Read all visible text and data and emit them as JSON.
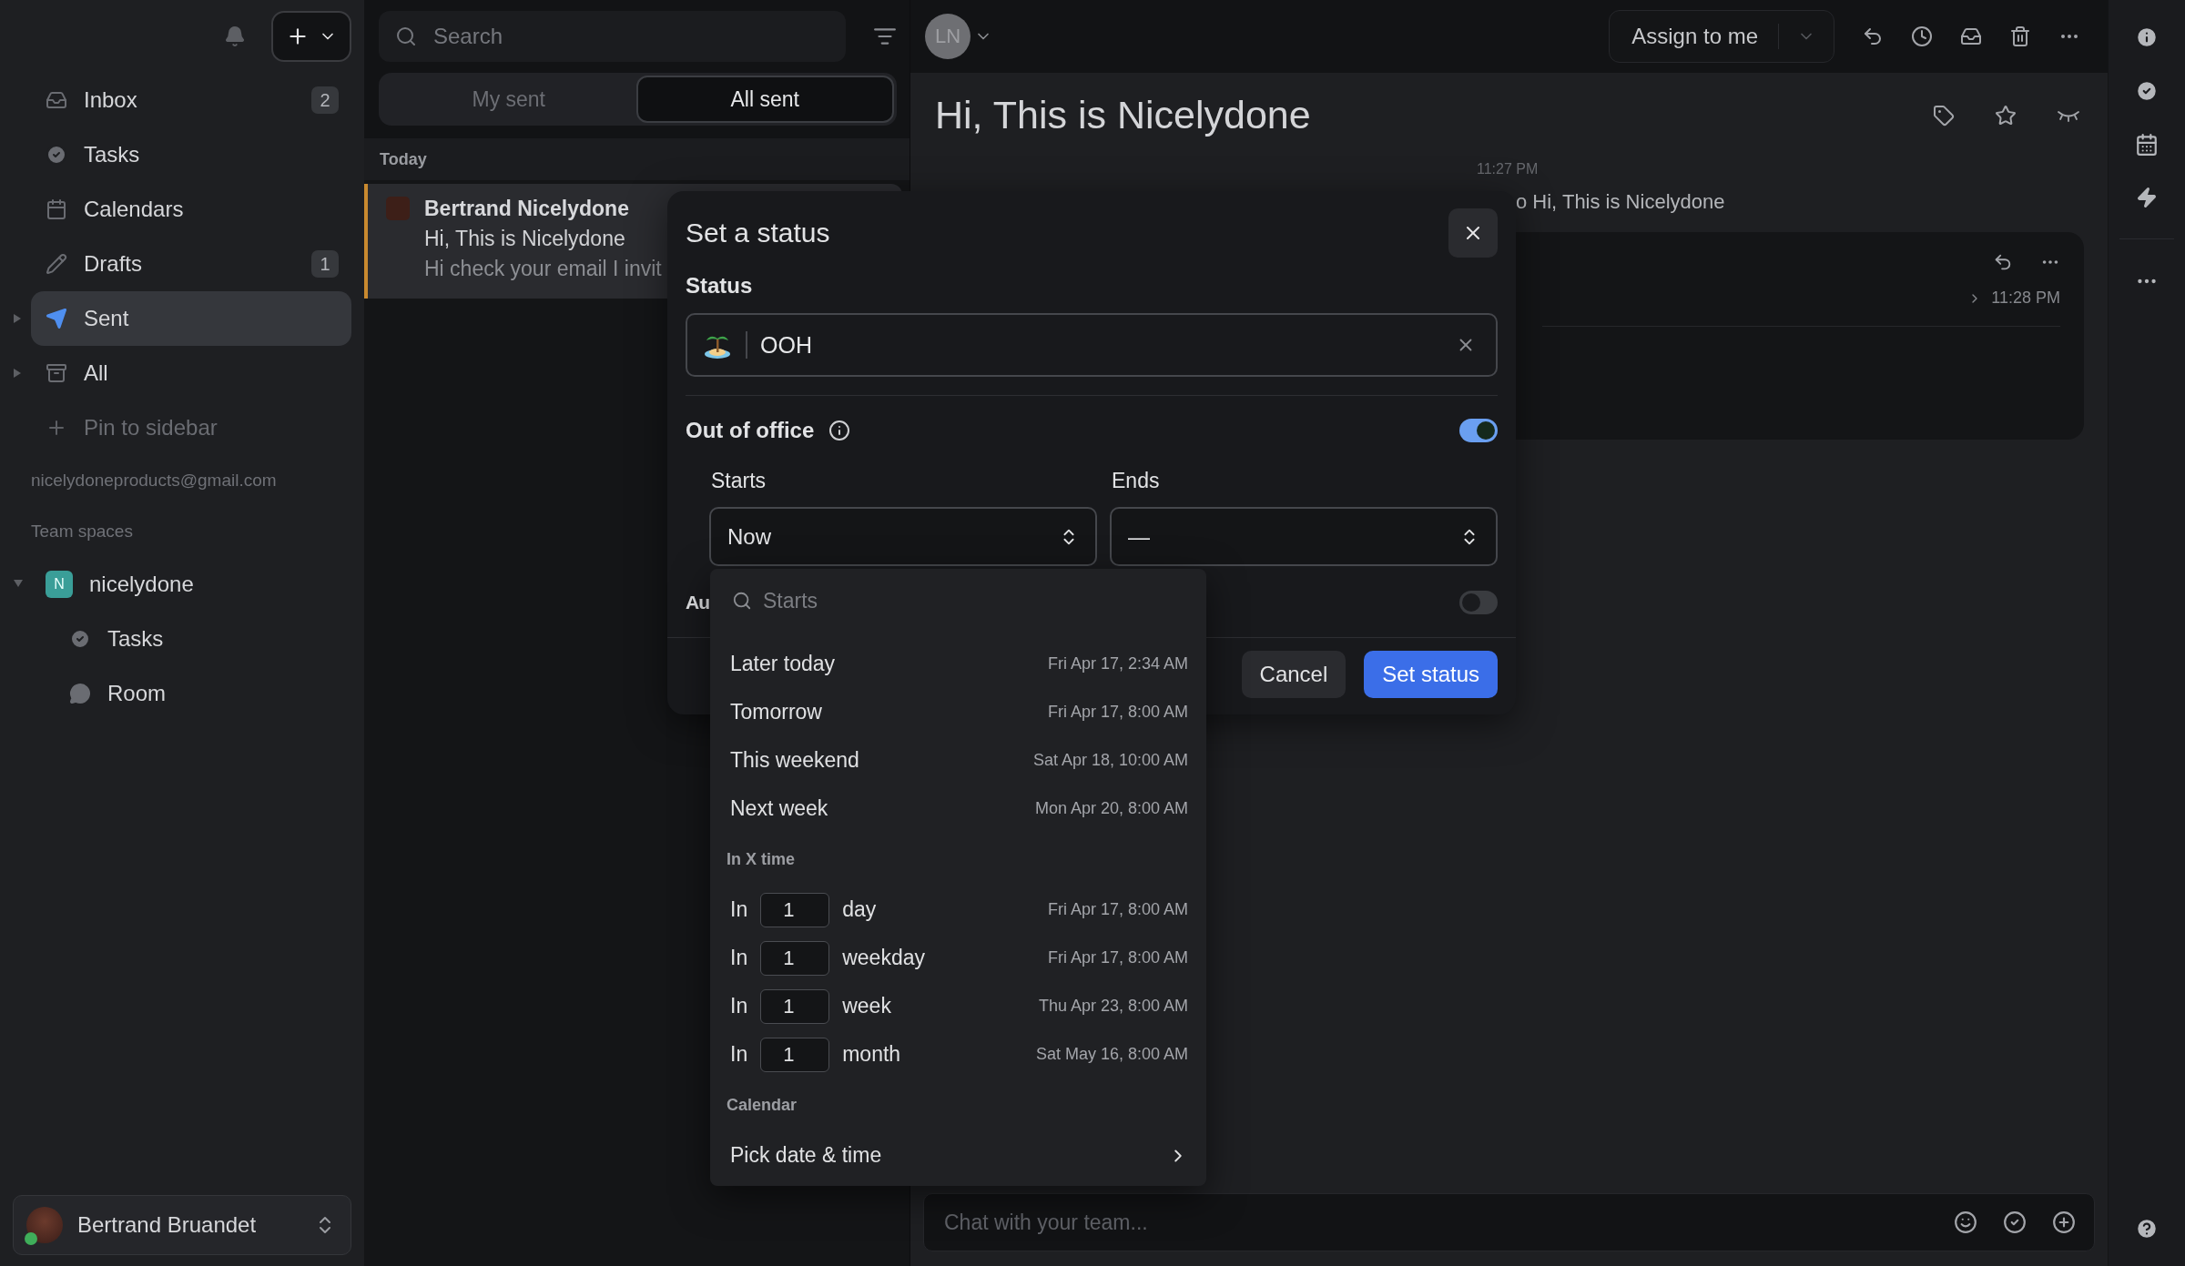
{
  "sidebar": {
    "items": [
      {
        "label": "Inbox",
        "badge": "2",
        "selected": false,
        "expandable": false
      },
      {
        "label": "Tasks",
        "selected": false,
        "expandable": false
      },
      {
        "label": "Calendars",
        "selected": false,
        "expandable": false
      },
      {
        "label": "Drafts",
        "badge": "1",
        "selected": false,
        "expandable": false
      },
      {
        "label": "Sent",
        "selected": true,
        "expandable": true
      },
      {
        "label": "All",
        "selected": false,
        "expandable": true
      }
    ],
    "pin_action": "Pin to sidebar",
    "account": "nicelydoneproducts@gmail.com",
    "team_spaces_heading": "Team spaces",
    "team": {
      "initial": "N",
      "name": "nicelydone",
      "expanded": true,
      "children": [
        {
          "label": "Tasks"
        },
        {
          "label": "Room"
        }
      ]
    },
    "user": {
      "name": "Bertrand Bruandet"
    }
  },
  "message_list": {
    "search": {
      "placeholder": "Search"
    },
    "tabs": [
      {
        "label": "My sent",
        "selected": false
      },
      {
        "label": "All sent",
        "selected": true
      }
    ],
    "group": "Today",
    "items": [
      {
        "sender": "Bertrand Nicelydone",
        "subject": "Hi, This is Nicelydone",
        "preview": "Hi check your email I invit",
        "selected": true
      }
    ]
  },
  "conversation": {
    "avatar_initials": "LN",
    "assign_button": "Assign to me",
    "title": "Hi, This is Nicelydone",
    "timestamp": "11:27 PM",
    "activity": "o Hi, This is Nicelydone",
    "message_time": "11:28 PM",
    "chat": {
      "placeholder": "Chat with your team..."
    }
  },
  "dialog": {
    "title": "Set a status",
    "status_label": "Status",
    "status": {
      "value": "OOH"
    },
    "out_of_office": {
      "label": "Out of office",
      "on": true
    },
    "starts": {
      "label": "Starts",
      "value": "Now"
    },
    "ends": {
      "label": "Ends",
      "value": "—"
    },
    "auto_row": {
      "label": "Au",
      "on": false
    },
    "buttons": [
      {
        "label": "Cancel",
        "kind": "secondary"
      },
      {
        "label": "Set status",
        "kind": "primary"
      }
    ]
  },
  "starts_menu": {
    "search": {
      "placeholder": "Starts"
    },
    "presets": [
      {
        "label": "Later today",
        "date": "Fri Apr 17, 2:34 AM"
      },
      {
        "label": "Tomorrow",
        "date": "Fri Apr 17, 8:00 AM"
      },
      {
        "label": "This weekend",
        "date": "Sat Apr 18, 10:00 AM"
      },
      {
        "label": "Next week",
        "date": "Mon Apr 20, 8:00 AM"
      }
    ],
    "relative_heading": "In X time",
    "relative": [
      {
        "prefix": "In",
        "amount": "1",
        "unit": "day",
        "date": "Fri Apr 17, 8:00 AM"
      },
      {
        "prefix": "In",
        "amount": "1",
        "unit": "weekday",
        "date": "Fri Apr 17, 8:00 AM"
      },
      {
        "prefix": "In",
        "amount": "1",
        "unit": "week",
        "date": "Thu Apr 23, 8:00 AM"
      },
      {
        "prefix": "In",
        "amount": "1",
        "unit": "month",
        "date": "Sat May 16, 8:00 AM"
      }
    ],
    "calendar_heading": "Calendar",
    "pick": "Pick date & time"
  }
}
